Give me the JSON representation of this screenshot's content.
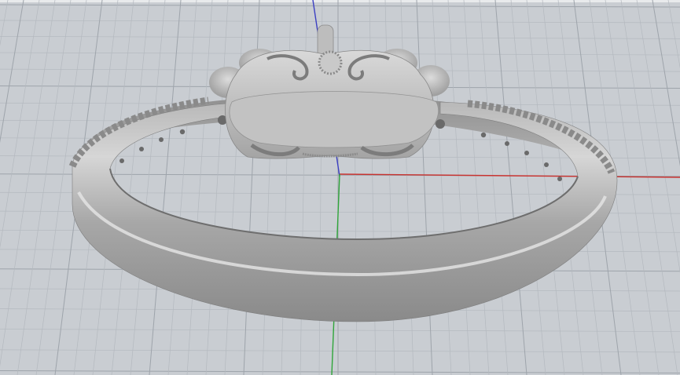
{
  "viewport": {
    "projection": "perspective",
    "background_color": "#c9cdd2",
    "grid_minor_color": "#b4b9bf",
    "grid_major_color": "#9ea4ab",
    "axis_x_color": "#c8322f",
    "axis_y_color": "#2fa53a",
    "axis_z_color": "#3b3fc2",
    "grid_visible": true,
    "axes_visible": true
  },
  "model": {
    "object": "ring",
    "material_color": "#a9a9a9",
    "shading": "rendered"
  }
}
